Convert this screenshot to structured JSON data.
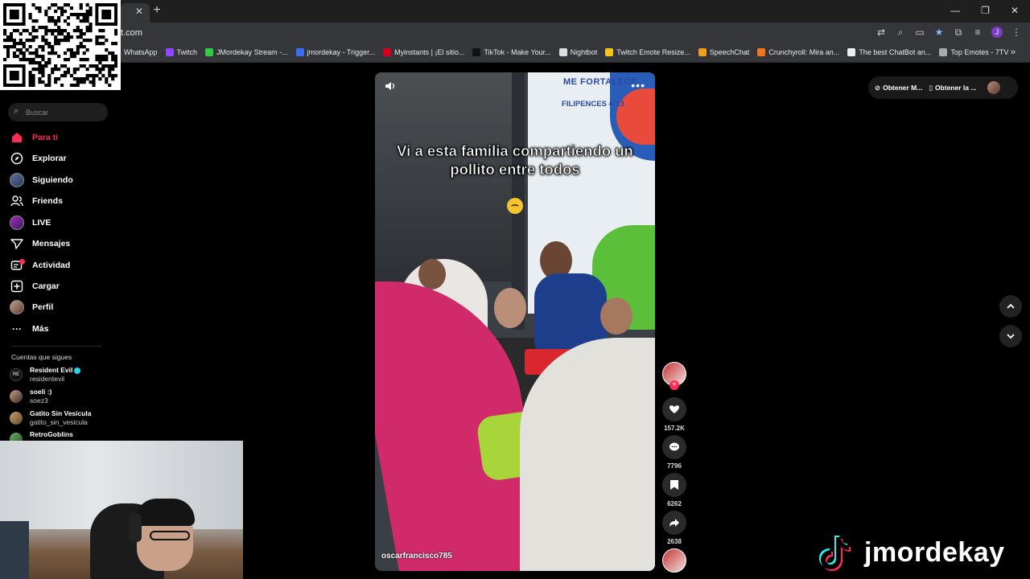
{
  "browser": {
    "tab_close": "✕",
    "new_tab": "+",
    "url": "t.com",
    "window_controls": [
      "—",
      "❐",
      "✕"
    ],
    "bookmarks": [
      {
        "label": "WhatsApp",
        "color": "#25d366"
      },
      {
        "label": "Twitch",
        "color": "#9146ff"
      },
      {
        "label": "JMordekay Stream -...",
        "color": "#2ecc40"
      },
      {
        "label": "jmordekay - Trigger...",
        "color": "#3b6cf6"
      },
      {
        "label": "Myinstants | ¡El sitio...",
        "color": "#d0021b"
      },
      {
        "label": "TikTok - Make Your...",
        "color": "#111111"
      },
      {
        "label": "Nightbot",
        "color": "#dddddd"
      },
      {
        "label": "Twitch Emote Resize...",
        "color": "#f5c518"
      },
      {
        "label": "SpeechChat",
        "color": "#f0a020"
      },
      {
        "label": "Crunchyroll: Mira an...",
        "color": "#f47521"
      },
      {
        "label": "The best ChatBot an...",
        "color": "#eeeeee"
      },
      {
        "label": "Top Emotes - 7TV",
        "color": "#aaaaaa"
      }
    ],
    "bookmarks_more": "»"
  },
  "sidebar": {
    "search_placeholder": "Buscar",
    "nav": [
      {
        "label": "Para ti",
        "icon": "home-icon",
        "active": true
      },
      {
        "label": "Explorar",
        "icon": "compass-icon"
      },
      {
        "label": "Siguiendo",
        "icon": "following-avatar"
      },
      {
        "label": "Friends",
        "icon": "friends-icon"
      },
      {
        "label": "LIVE",
        "icon": "live-icon"
      },
      {
        "label": "Mensajes",
        "icon": "send-icon"
      },
      {
        "label": "Actividad",
        "icon": "activity-icon"
      },
      {
        "label": "Cargar",
        "icon": "upload-icon"
      },
      {
        "label": "Perfil",
        "icon": "profile-avatar"
      },
      {
        "label": "Más",
        "icon": "more-icon"
      }
    ],
    "following_title": "Cuentas que sigues",
    "following": [
      {
        "name": "Resident Evil",
        "user": "residentevil",
        "verified": true
      },
      {
        "name": "soeli :)",
        "user": "soez3"
      },
      {
        "name": "Gatito Sin Vesícula",
        "user": "gatito_sin_vesicula"
      },
      {
        "name": "RetroGoblins",
        "user": ""
      }
    ]
  },
  "video": {
    "caption": "Vi a esta familia compartiendo un pollito entre todos",
    "wall_text_1": "ME FORTALECE",
    "wall_text_2": "FILIPENCES 4:13",
    "author": "oscarfrancisco785",
    "more": "•••"
  },
  "actions": {
    "likes": "157.2K",
    "comments": "7796",
    "saves": "6262",
    "shares": "2638"
  },
  "top_right": {
    "btn1": "Obtener M...",
    "btn2": "Obtener la ..."
  },
  "watermark": {
    "name": "jmordekay"
  }
}
